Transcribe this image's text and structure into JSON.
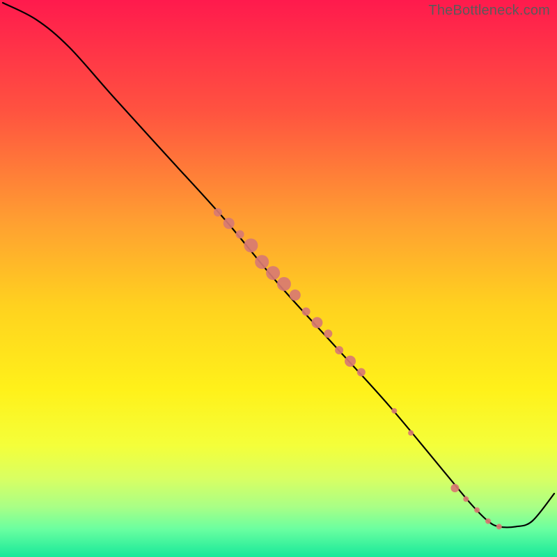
{
  "watermark": "TheBottleneck.com",
  "chart_data": {
    "type": "line",
    "title": "",
    "xlabel": "",
    "ylabel": "",
    "xlim": [
      0,
      100
    ],
    "ylim": [
      0,
      100
    ],
    "grid": false,
    "series": [
      {
        "name": "curve",
        "x": [
          0,
          6,
          12,
          20,
          30,
          40,
          50,
          60,
          70,
          80,
          85,
          88,
          90,
          93,
          96,
          100
        ],
        "y": [
          100,
          97,
          92,
          83,
          72,
          61,
          49,
          38,
          27,
          15,
          9,
          6,
          5,
          5,
          6,
          11
        ]
      }
    ],
    "markers": {
      "name": "highlighted-points",
      "color": "#d87a72",
      "sizes": [
        6,
        8,
        6,
        10,
        10,
        10,
        10,
        8,
        6,
        8,
        6,
        6,
        8,
        6,
        4,
        4,
        6,
        4,
        4,
        4,
        4
      ],
      "x": [
        39,
        41,
        43,
        45,
        47,
        49,
        51,
        53,
        55,
        57,
        59,
        61,
        63,
        65,
        71,
        74,
        82,
        84,
        86,
        88,
        90
      ],
      "y": [
        62,
        60,
        58,
        56,
        53,
        51,
        49,
        47,
        44,
        42,
        40,
        37,
        35,
        33,
        26,
        22,
        12,
        10,
        8,
        6,
        5
      ]
    },
    "gradient_stops": [
      {
        "offset": 0.0,
        "color": "#ff1a4d"
      },
      {
        "offset": 0.2,
        "color": "#ff5340"
      },
      {
        "offset": 0.4,
        "color": "#ffa031"
      },
      {
        "offset": 0.55,
        "color": "#ffd21f"
      },
      {
        "offset": 0.7,
        "color": "#fff11a"
      },
      {
        "offset": 0.8,
        "color": "#f4ff3a"
      },
      {
        "offset": 0.86,
        "color": "#d8ff63"
      },
      {
        "offset": 0.91,
        "color": "#a9ff86"
      },
      {
        "offset": 0.95,
        "color": "#6affa0"
      },
      {
        "offset": 1.0,
        "color": "#17e89a"
      }
    ]
  }
}
